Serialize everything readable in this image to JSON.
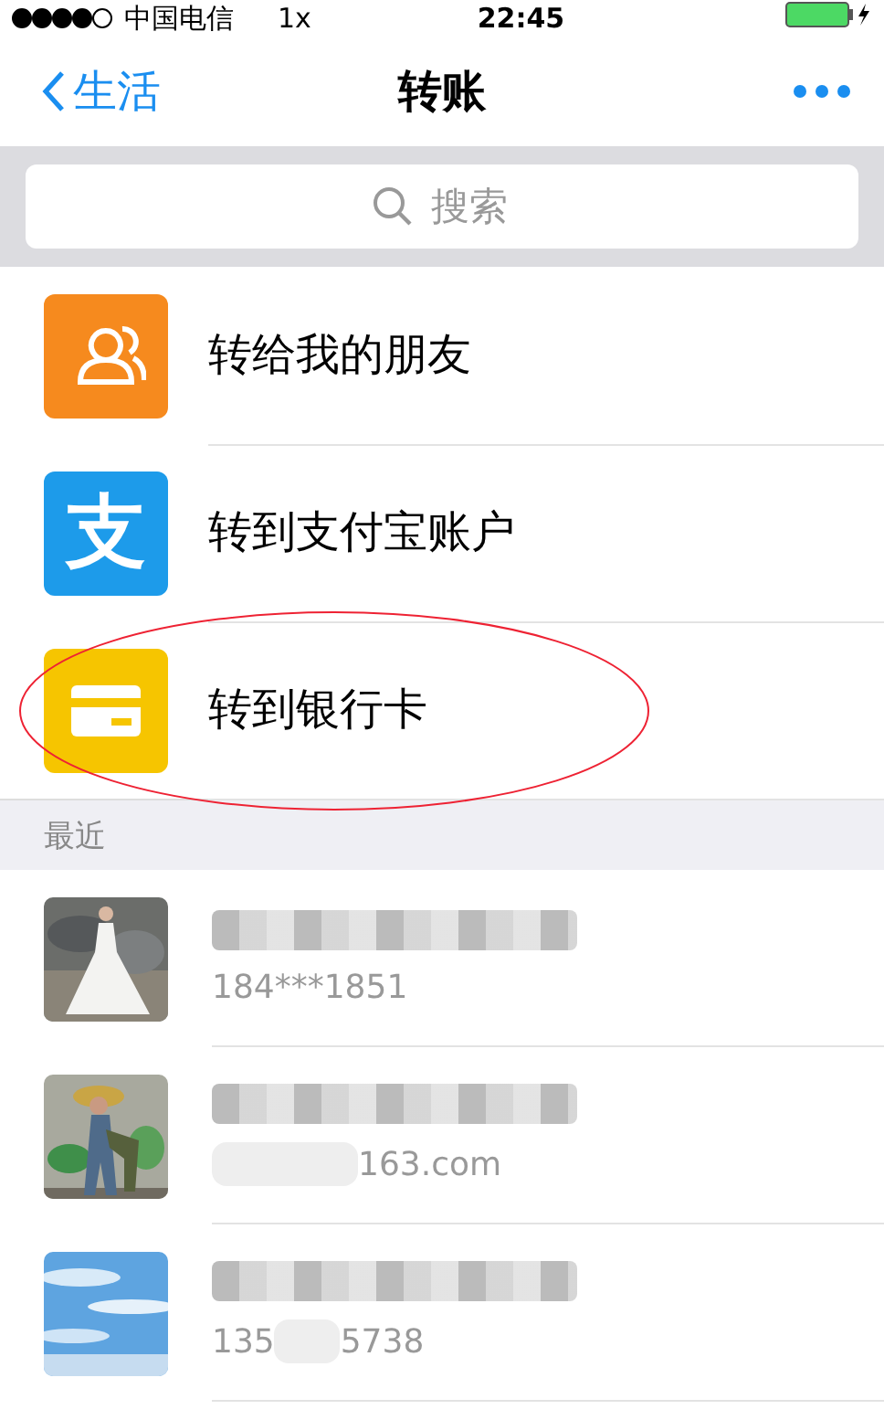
{
  "status_bar": {
    "carrier": "中国电信",
    "network": "1x",
    "time": "22:45"
  },
  "nav": {
    "back": "生活",
    "title": "转账"
  },
  "search": {
    "placeholder": "搜索"
  },
  "options": [
    {
      "kind": "friends",
      "label": "转给我的朋友",
      "color": "#f68a1e",
      "highlighted": false
    },
    {
      "kind": "alipay",
      "label": "转到支付宝账户",
      "color": "#1d9bea",
      "glyph": "支",
      "highlighted": false
    },
    {
      "kind": "card",
      "label": "转到银行卡",
      "color": "#f6c500",
      "highlighted": true
    }
  ],
  "recent": {
    "title": "最近",
    "contacts": [
      {
        "kind": "picture",
        "name_masked": true,
        "detail": [
          {
            "text": "184***1851",
            "masked_before": false
          }
        ]
      },
      {
        "kind": "picture",
        "name_masked": true,
        "detail": [
          {
            "text": "163.com",
            "masked_before": true
          }
        ]
      },
      {
        "kind": "picture",
        "name_masked": true,
        "detail": [
          {
            "text": "135",
            "masked_before": false
          },
          {
            "text": "5738",
            "masked_before": true
          }
        ]
      }
    ]
  }
}
